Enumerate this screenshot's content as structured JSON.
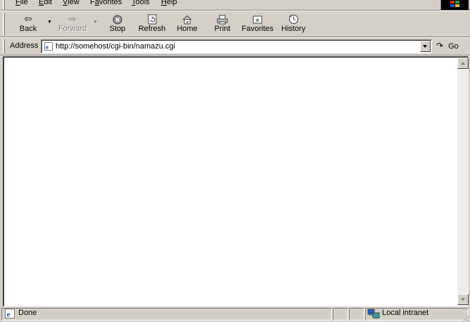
{
  "menubar": {
    "items": [
      {
        "label": "File",
        "accel": "F",
        "rest": "ile"
      },
      {
        "label": "Edit",
        "accel": "E",
        "rest": "dit"
      },
      {
        "label": "View",
        "accel": "V",
        "rest": "iew"
      },
      {
        "label": "Favorites",
        "accel": "a",
        "pre": "F",
        "rest": "vorites"
      },
      {
        "label": "Tools",
        "accel": "T",
        "rest": "ools"
      },
      {
        "label": "Help",
        "accel": "H",
        "rest": "elp"
      }
    ]
  },
  "toolbar": {
    "back_label": "Back",
    "forward_label": "Forward",
    "stop_label": "Stop",
    "refresh_label": "Refresh",
    "home_label": "Home",
    "print_label": "Print",
    "favorites_label": "Favorites",
    "history_label": "History"
  },
  "address": {
    "label": "Address",
    "url": "http://somehost/cgi-bin/namazu.cgi",
    "go_label": "Go"
  },
  "status": {
    "text": "Done",
    "zone": "Local intranet"
  },
  "colors": {
    "chrome": "#d4d0c8",
    "content_bg": "#ffffff",
    "shadow": "#808080",
    "highlight": "#ffffff"
  },
  "icons": [
    "back-icon",
    "forward-icon",
    "stop-icon",
    "refresh-icon",
    "home-icon",
    "print-icon",
    "favorites-icon",
    "history-icon",
    "ie-page-icon",
    "go-icon",
    "local-intranet-icon",
    "windows-logo-icon"
  ]
}
